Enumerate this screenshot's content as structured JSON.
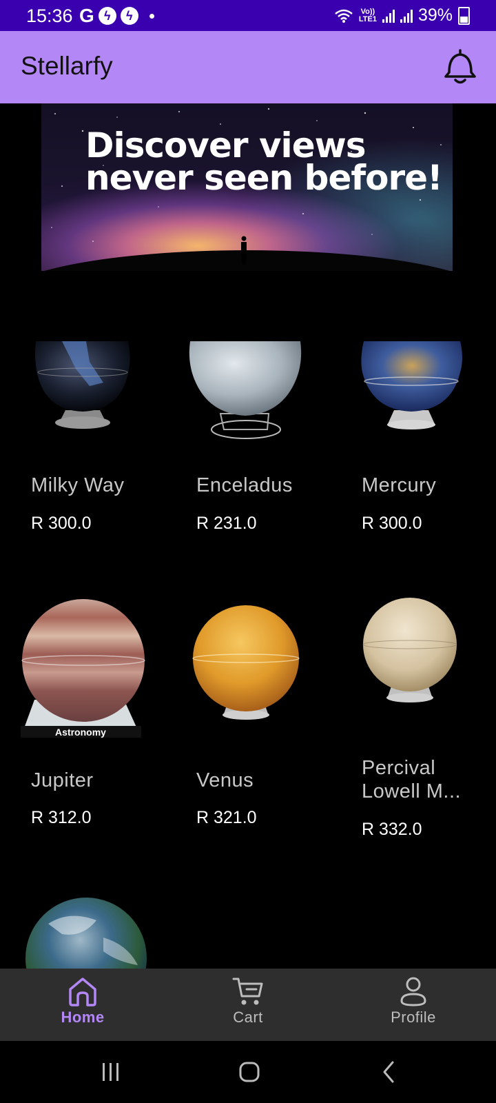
{
  "status_bar": {
    "time": "15:36",
    "carrier_glyph": "G",
    "network_label_top": "Vo))",
    "network_label_bottom": "LTE1",
    "battery": "39%"
  },
  "app_bar": {
    "title": "Stellarfy",
    "notification_icon": "bell-icon"
  },
  "banner": {
    "headline": "Discover views\nnever seen before!"
  },
  "products": [
    {
      "name": "Milky Way",
      "price": "R 300.0"
    },
    {
      "name": "Enceladus",
      "price": "R 231.0"
    },
    {
      "name": "Mercury",
      "price": "R 300.0"
    },
    {
      "name": "Jupiter",
      "price": "R 312.0"
    },
    {
      "name": "Venus",
      "price": "R 321.0"
    },
    {
      "name": "Percival Lowell M...",
      "price": "R 332.0"
    },
    {
      "name": "",
      "price": ""
    }
  ],
  "bottom_nav": {
    "items": [
      {
        "label": "Home",
        "icon": "home-icon",
        "active": true
      },
      {
        "label": "Cart",
        "icon": "cart-icon",
        "active": false
      },
      {
        "label": "Profile",
        "icon": "profile-icon",
        "active": false
      }
    ]
  },
  "system_nav": {
    "icons": [
      "recent-apps-icon",
      "home-circle-icon",
      "back-icon"
    ]
  },
  "colors": {
    "status_bar": "#3a00b0",
    "app_bar": "#b388f6",
    "accent": "#b388f6",
    "background": "#000000",
    "bottom_nav": "#2e2e2e"
  }
}
